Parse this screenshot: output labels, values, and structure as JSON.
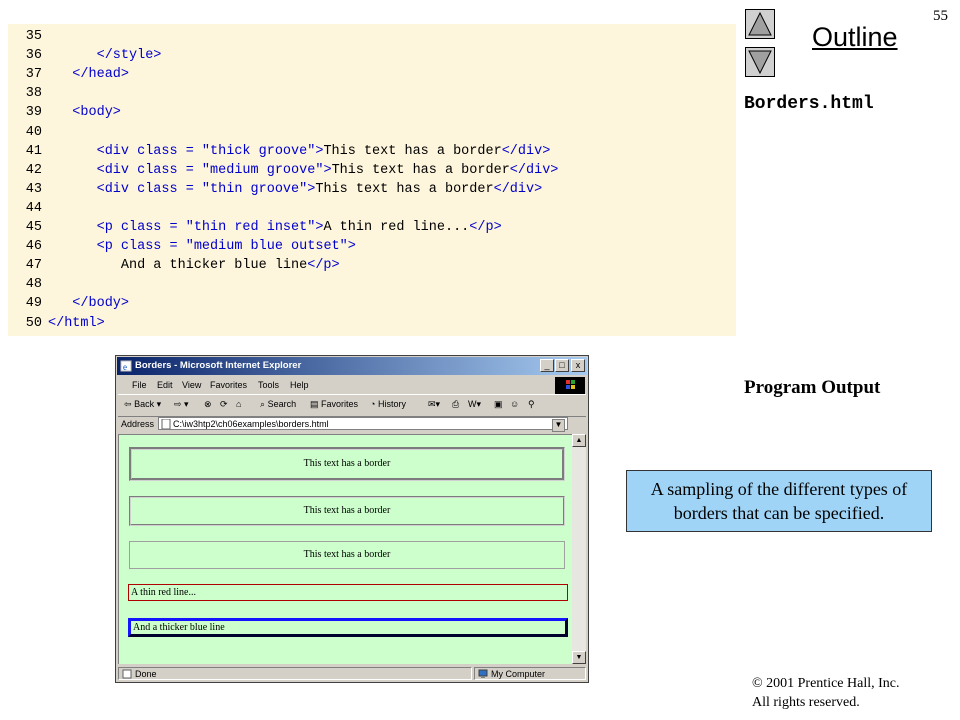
{
  "slide": {
    "page_number": "55",
    "outline_label": "Outline",
    "file_name": "Borders.html",
    "program_output": "Program Output",
    "callout": "A sampling of the different types of borders that can be specified.",
    "copyright_line1": "© 2001 Prentice Hall, Inc.",
    "copyright_line2": "All rights reserved."
  },
  "code_lines": [
    {
      "num": "35",
      "indent": 0,
      "segments": []
    },
    {
      "num": "36",
      "indent": 6,
      "segments": [
        {
          "t": "</style>",
          "c": "tag"
        }
      ]
    },
    {
      "num": "37",
      "indent": 3,
      "segments": [
        {
          "t": "</head>",
          "c": "tag"
        }
      ]
    },
    {
      "num": "38",
      "indent": 0,
      "segments": []
    },
    {
      "num": "39",
      "indent": 3,
      "segments": [
        {
          "t": "<body>",
          "c": "tag"
        }
      ]
    },
    {
      "num": "40",
      "indent": 0,
      "segments": []
    },
    {
      "num": "41",
      "indent": 6,
      "segments": [
        {
          "t": "<div class = ",
          "c": "tag"
        },
        {
          "t": "\"thick groove\"",
          "c": "str"
        },
        {
          "t": ">",
          "c": "tag"
        },
        {
          "t": "This text has a border",
          "c": ""
        },
        {
          "t": "</div>",
          "c": "tag"
        }
      ]
    },
    {
      "num": "42",
      "indent": 6,
      "segments": [
        {
          "t": "<div class = ",
          "c": "tag"
        },
        {
          "t": "\"medium groove\"",
          "c": "str"
        },
        {
          "t": ">",
          "c": "tag"
        },
        {
          "t": "This text has a border",
          "c": ""
        },
        {
          "t": "</div>",
          "c": "tag"
        }
      ]
    },
    {
      "num": "43",
      "indent": 6,
      "segments": [
        {
          "t": "<div class = ",
          "c": "tag"
        },
        {
          "t": "\"thin groove\"",
          "c": "str"
        },
        {
          "t": ">",
          "c": "tag"
        },
        {
          "t": "This text has a border",
          "c": ""
        },
        {
          "t": "</div>",
          "c": "tag"
        }
      ]
    },
    {
      "num": "44",
      "indent": 0,
      "segments": []
    },
    {
      "num": "45",
      "indent": 6,
      "segments": [
        {
          "t": "<p class = ",
          "c": "tag"
        },
        {
          "t": "\"thin red inset\"",
          "c": "str"
        },
        {
          "t": ">",
          "c": "tag"
        },
        {
          "t": "A thin red line...",
          "c": ""
        },
        {
          "t": "</p>",
          "c": "tag"
        }
      ]
    },
    {
      "num": "46",
      "indent": 6,
      "segments": [
        {
          "t": "<p class = ",
          "c": "tag"
        },
        {
          "t": "\"medium blue outset\"",
          "c": "str"
        },
        {
          "t": ">",
          "c": "tag"
        }
      ]
    },
    {
      "num": "47",
      "indent": 9,
      "segments": [
        {
          "t": "And a thicker blue line",
          "c": ""
        },
        {
          "t": "</p>",
          "c": "tag"
        }
      ]
    },
    {
      "num": "48",
      "indent": 0,
      "segments": []
    },
    {
      "num": "49",
      "indent": 3,
      "segments": [
        {
          "t": "</body>",
          "c": "tag"
        }
      ]
    },
    {
      "num": "50",
      "indent": 0,
      "segments": [
        {
          "t": "</html>",
          "c": "tag"
        }
      ]
    }
  ],
  "browser": {
    "title": "Borders - Microsoft Internet Explorer",
    "window_buttons": {
      "minimize": "_",
      "maximize": "□",
      "close": "x"
    },
    "menu": [
      "File",
      "Edit",
      "View",
      "Favorites",
      "Tools",
      "Help"
    ],
    "toolbar": {
      "back": "Back",
      "search": "Search",
      "favorites": "Favorites",
      "history": "History"
    },
    "address_label": "Address",
    "address_value": "C:\\iw3htp2\\ch06examples\\borders.html",
    "content": {
      "box1": "This text has a border",
      "box2": "This text has a border",
      "box3": "This text has a border",
      "para1": "A thin red line...",
      "para2": "And a thicker blue line"
    },
    "status_left": "Done",
    "status_right": "My Computer"
  },
  "colors": {
    "code_bg": "#fdf5dc",
    "code_tag": "#0000cc",
    "callout_bg": "#9fd4f7",
    "content_bg": "#ccffcc",
    "red_border": "#b00000",
    "blue_border": "#0000ff"
  }
}
